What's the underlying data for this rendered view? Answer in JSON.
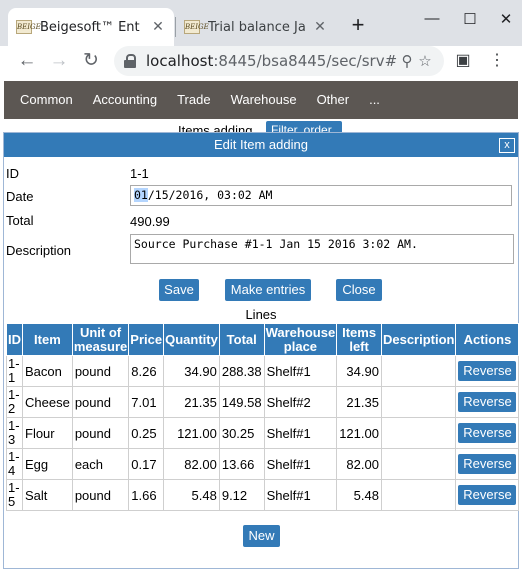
{
  "browser": {
    "tabs": [
      {
        "favicon_text": "BEIGE",
        "title": "Beigesoft™ Ent",
        "active": true
      },
      {
        "favicon_text": "BEIGE",
        "title": "Trial balance Ja",
        "active": false
      }
    ],
    "url_host": "localhost",
    "url_rest": ":8445/bsa8445/sec/srv#"
  },
  "menu": {
    "items": [
      "Common",
      "Accounting",
      "Trade",
      "Warehouse",
      "Other",
      "..."
    ]
  },
  "background": {
    "title": "Items adding",
    "button": "Filter, order"
  },
  "dialog": {
    "title": "Edit Item adding",
    "close": "x",
    "fields": {
      "id_label": "ID",
      "id_value": "1-1",
      "date_label": "Date",
      "date_selected": "01",
      "date_rest": "/15/2016, 03:02 AM",
      "total_label": "Total",
      "total_value": "490.99",
      "description_label": "Description",
      "description_value": "Source Purchase #1-1 Jan 15 2016 3:02 AM."
    },
    "buttons": {
      "save": "Save",
      "make_entries": "Make entries",
      "close": "Close",
      "new": "New"
    },
    "lines_caption": "Lines",
    "table": {
      "headers": [
        "ID",
        "Item",
        "Unit of measure",
        "Price",
        "Quantity",
        "Total",
        "Warehouse place",
        "Items left",
        "Description",
        "Actions"
      ],
      "rows": [
        {
          "id": "1-1",
          "item": "Bacon",
          "unit": "pound",
          "price": "8.26",
          "quantity": "34.90",
          "total": "288.38",
          "place": "Shelf#1",
          "left": "34.90",
          "description": "",
          "action": "Reverse"
        },
        {
          "id": "1-2",
          "item": "Cheese",
          "unit": "pound",
          "price": "7.01",
          "quantity": "21.35",
          "total": "149.58",
          "place": "Shelf#2",
          "left": "21.35",
          "description": "",
          "action": "Reverse"
        },
        {
          "id": "1-3",
          "item": "Flour",
          "unit": "pound",
          "price": "0.25",
          "quantity": "121.00",
          "total": "30.25",
          "place": "Shelf#1",
          "left": "121.00",
          "description": "",
          "action": "Reverse"
        },
        {
          "id": "1-4",
          "item": "Egg",
          "unit": "each",
          "price": "0.17",
          "quantity": "82.00",
          "total": "13.66",
          "place": "Shelf#1",
          "left": "82.00",
          "description": "",
          "action": "Reverse"
        },
        {
          "id": "1-5",
          "item": "Salt",
          "unit": "pound",
          "price": "1.66",
          "quantity": "5.48",
          "total": "9.12",
          "place": "Shelf#1",
          "left": "5.48",
          "description": "",
          "action": "Reverse"
        }
      ]
    }
  }
}
